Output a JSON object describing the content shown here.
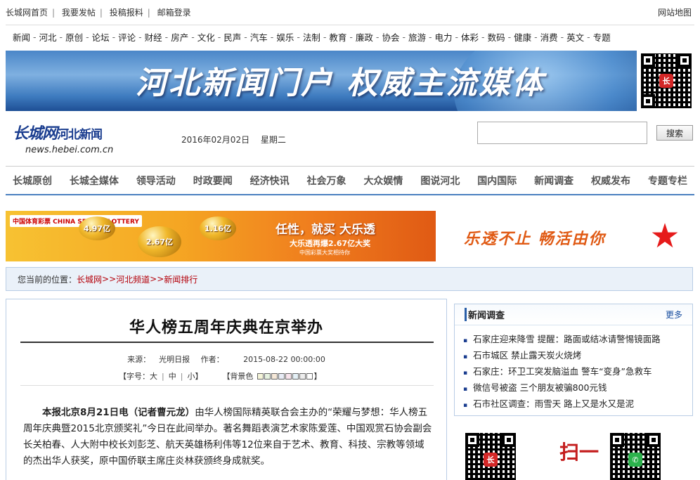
{
  "top_links": [
    "长城网首页",
    "我要发帖",
    "投稿报料",
    "邮箱登录"
  ],
  "site_map": "网站地图",
  "channels": [
    "新闻",
    "河北",
    "原创",
    "论坛",
    "评论",
    "财经",
    "房产",
    "文化",
    "民声",
    "汽车",
    "娱乐",
    "法制",
    "教育",
    "廉政",
    "协会",
    "旅游",
    "电力",
    "体彩",
    "数码",
    "健康",
    "消费",
    "英文",
    "专题"
  ],
  "banner": {
    "slogan": "河北新闻门户  权威主流媒体"
  },
  "logo": {
    "main": "长城网",
    "sub": "河北新闻",
    "url": "news.hebei.com.cn"
  },
  "date": "2016年02月02日 　星期二",
  "search": {
    "button": "搜索"
  },
  "main_nav": [
    "长城原创",
    "长城全媒体",
    "领导活动",
    "时政要闻",
    "经济快讯",
    "社会万象",
    "大众娱情",
    "图说河北",
    "国内国际",
    "新闻调查",
    "权威发布",
    "专题专栏"
  ],
  "ad": {
    "lottery_logo": "中国体育彩票 CHINA SPORTS LOTTERY",
    "ball_values": [
      "4.97亿",
      "2.67亿",
      "1.16亿"
    ],
    "promo_line1": "任性，就买 大乐透",
    "promo_line2": "大乐透再爆2.67亿大奖",
    "promo_line3": "中国彩票大奖相待你",
    "slogan": "乐透不止 畅活由你",
    "badge": "大乐透"
  },
  "breadcrumb": {
    "prefix": "您当前的位置：",
    "items": [
      "长城网",
      "河北频道",
      "新闻排行"
    ],
    "sep": ">>"
  },
  "article": {
    "title": "华人榜五周年庆典在京举办",
    "source_label": "来源：",
    "source": "光明日报",
    "author_label": "作者：",
    "author": "",
    "datetime": "2015-08-22 00:00:00",
    "font_label": "【字号：",
    "font_sizes": [
      "大",
      "中",
      "小"
    ],
    "font_end": "】",
    "bg_label": "【背景色",
    "bg_end": "】",
    "bg_colors": [
      "#f4f4d8",
      "#e6f2e0",
      "#f6e8d8",
      "#e8ecf6",
      "#f8e4ec",
      "#e4f0f6",
      "#eeeeee",
      "#ffffff"
    ],
    "lead": "本报北京8月21日电（记者曹元龙）",
    "body": "由华人榜国际精英联合会主办的“荣耀与梦想：华人榜五周年庆典暨2015北京颁奖礼”今日在此间举办。著名舞蹈表演艺术家陈爱莲、中国观赏石协会副会长关柏春、人大附中校长刘彭芝、航天英雄杨利伟等12位来自于艺术、教育、科技、宗教等领域的杰出华人获奖，原中国侨联主席庄炎林获颁终身成就奖。"
  },
  "survey": {
    "title": "新闻调查",
    "more": "更多",
    "items": [
      "石家庄迎来降雪  提醒：路面或结冰请警惕镜面路",
      "石市城区  禁止露天炭火烧烤",
      "石家庄：环卫工突发脑溢血  警车“变身”急救车",
      "微信号被盗  三个朋友被骗800元钱",
      "石市社区调查：雨雪天  路上又是水又是泥"
    ]
  },
  "qr_promo": {
    "scan_text": "扫一"
  },
  "icons": {
    "qr": "qr-code-icon",
    "star": "star-badge-icon"
  }
}
